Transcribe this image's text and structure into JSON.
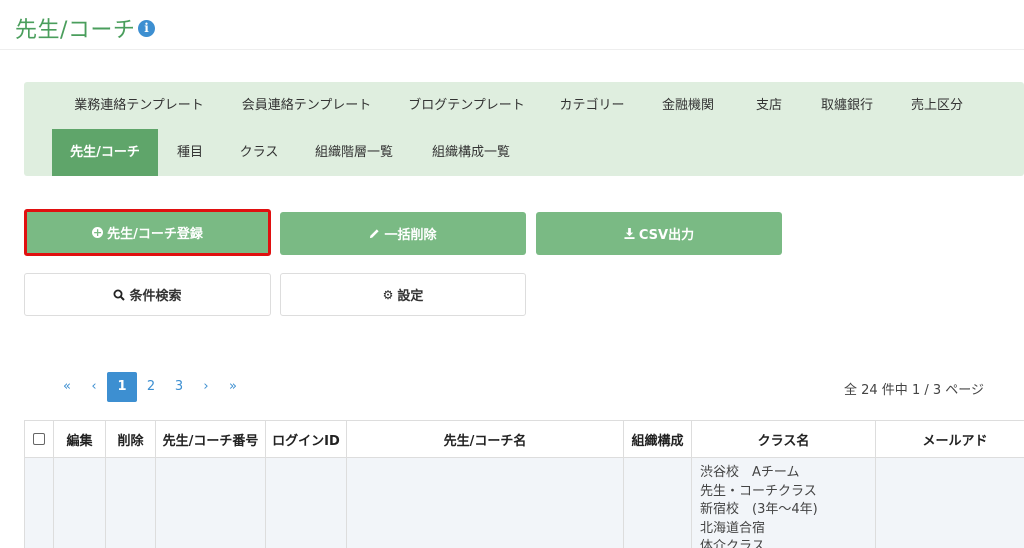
{
  "header": {
    "title": "先生/コーチ",
    "info_icon": "i"
  },
  "tabs": [
    {
      "label": "業務連絡テンプレート"
    },
    {
      "label": "会員連絡テンプレート"
    },
    {
      "label": "ブログテンプレート"
    },
    {
      "label": "カテゴリー"
    },
    {
      "label": "金融機関"
    },
    {
      "label": "支店"
    },
    {
      "label": "取纏銀行"
    },
    {
      "label": "売上区分"
    },
    {
      "label": "先生/コーチ",
      "active": true
    },
    {
      "label": "種目"
    },
    {
      "label": "クラス"
    },
    {
      "label": "組織階層一覧"
    },
    {
      "label": "組織構成一覧"
    }
  ],
  "actions": {
    "register": {
      "label": "先生/コーチ登録",
      "icon": "plus-circle-icon"
    },
    "bulk_delete": {
      "label": "一括削除",
      "icon": "pencil-icon"
    },
    "csv_export": {
      "label": "CSV出力",
      "icon": "download-icon"
    },
    "search": {
      "label": "条件検索",
      "icon": "search-icon"
    },
    "settings": {
      "label": "設定",
      "icon": "gear-icon"
    }
  },
  "pagination": {
    "first": "«",
    "prev": "‹",
    "pages": [
      "1",
      "2",
      "3"
    ],
    "current": "1",
    "next": "›",
    "last": "»",
    "summary": "全 24 件中 1 / 3 ページ"
  },
  "table": {
    "columns": [
      "",
      "編集",
      "削除",
      "先生/コーチ番号",
      "ログインID",
      "先生/コーチ名",
      "組織構成",
      "クラス名",
      "メールアド"
    ],
    "rows": [
      {
        "classes": [
          "渋谷校　Aチーム",
          "先生・コーチクラス",
          "新宿校　(3年〜4年)",
          "北海道合宿",
          "体介クラス"
        ]
      }
    ]
  },
  "colors": {
    "accent": "#4a9e5c",
    "tab_bg": "#dfeedf",
    "tab_active": "#5fa56a",
    "button_green": "#7aba84",
    "link_blue": "#3d8fd1",
    "highlight_red": "#e01010"
  }
}
